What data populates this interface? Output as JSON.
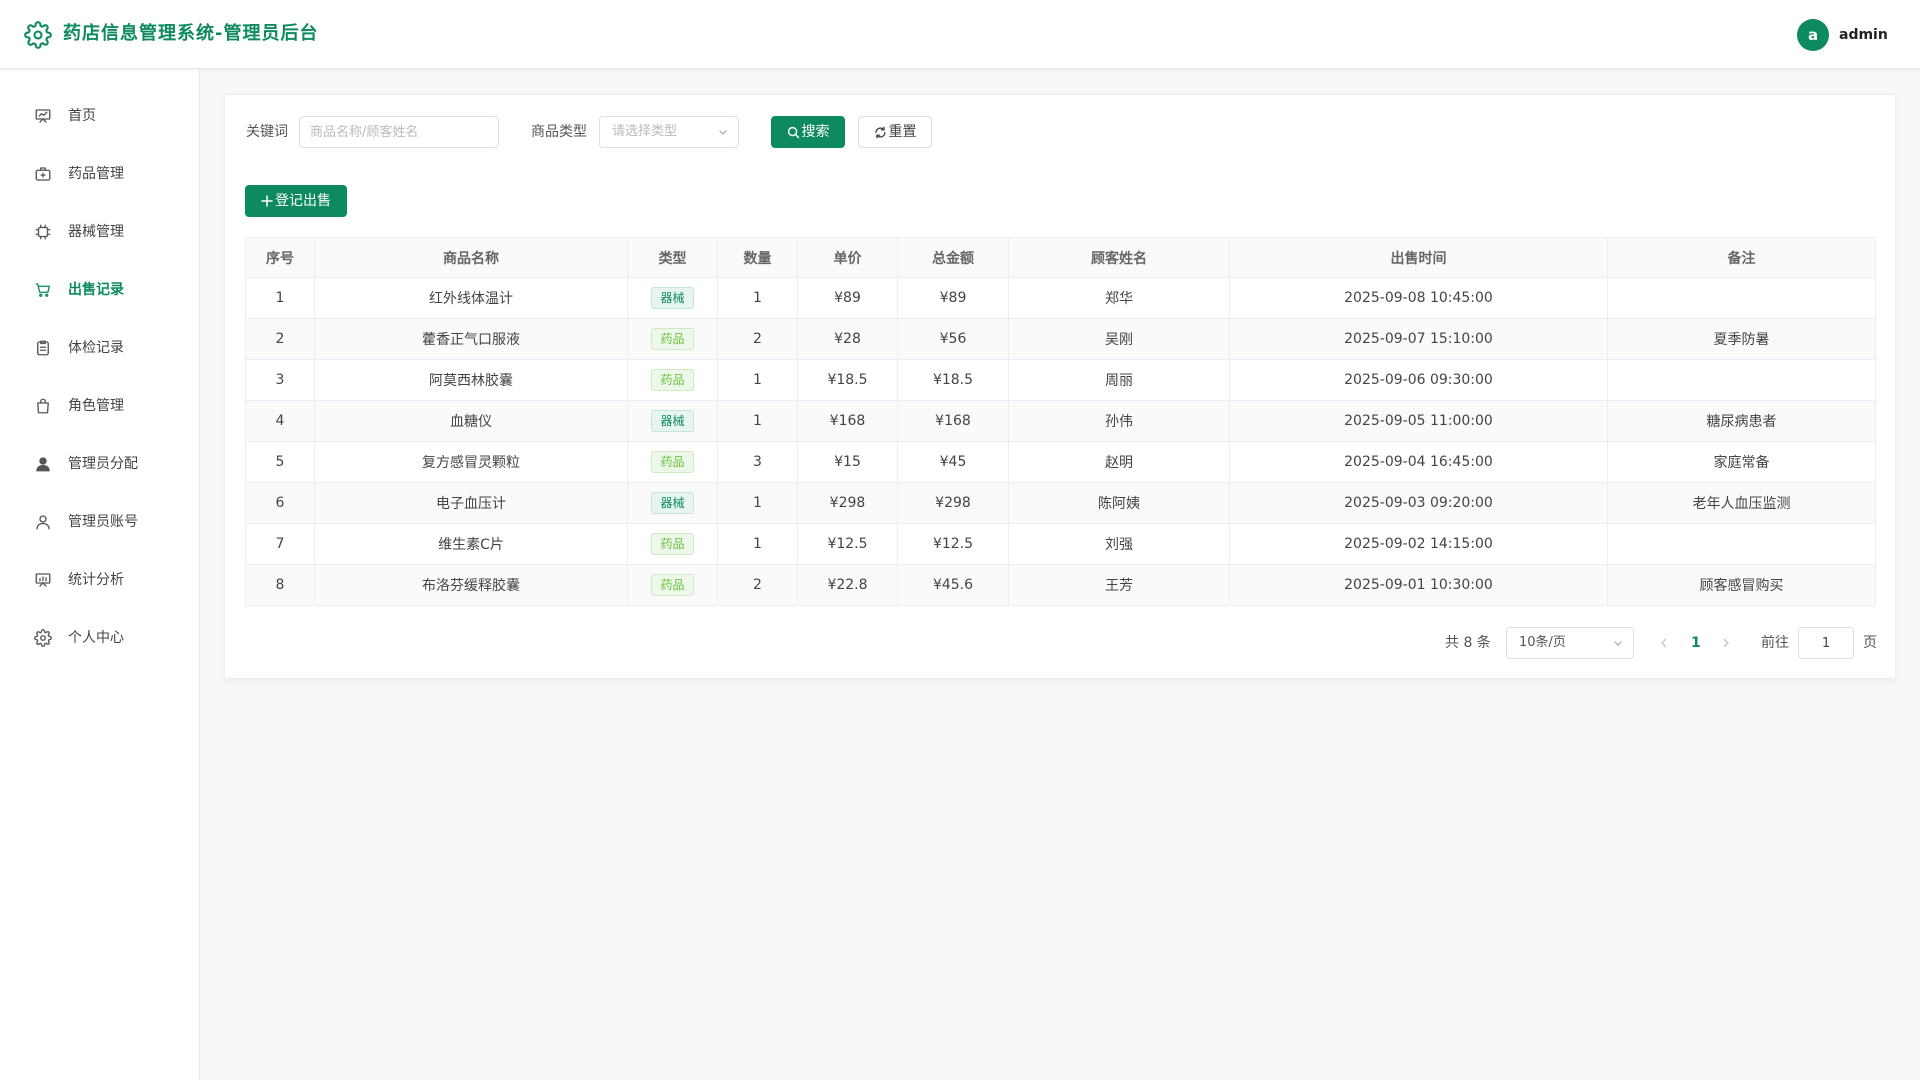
{
  "header": {
    "title": "药店信息管理系统-管理员后台",
    "avatar_letter": "a",
    "username": "admin"
  },
  "colors": {
    "primary": "#0e8a5f",
    "drug_tag": "#67c23a"
  },
  "sidebar": {
    "items": [
      {
        "label": "首页",
        "icon": "dashboard-icon",
        "active": false
      },
      {
        "label": "药品管理",
        "icon": "medical-kit-icon",
        "active": false
      },
      {
        "label": "器械管理",
        "icon": "chip-icon",
        "active": false
      },
      {
        "label": "出售记录",
        "icon": "cart-icon",
        "active": true
      },
      {
        "label": "体检记录",
        "icon": "clipboard-icon",
        "active": false
      },
      {
        "label": "角色管理",
        "icon": "bag-icon",
        "active": false
      },
      {
        "label": "管理员分配",
        "icon": "user-filled-icon",
        "active": false
      },
      {
        "label": "管理员账号",
        "icon": "user-icon",
        "active": false
      },
      {
        "label": "统计分析",
        "icon": "chart-icon",
        "active": false
      },
      {
        "label": "个人中心",
        "icon": "gear-icon",
        "active": false
      }
    ]
  },
  "filters": {
    "keyword_label": "关键词",
    "keyword_placeholder": "商品名称/顾客姓名",
    "type_label": "商品类型",
    "type_placeholder": "请选择类型",
    "search_label": "搜索",
    "reset_label": "重置"
  },
  "add_button_label": "登记出售",
  "table": {
    "columns": [
      "序号",
      "商品名称",
      "类型",
      "数量",
      "单价",
      "总金额",
      "顾客姓名",
      "出售时间",
      "备注"
    ],
    "rows": [
      {
        "no": "1",
        "name": "红外线体温计",
        "type": "器械",
        "qty": "1",
        "price": "¥89",
        "total": "¥89",
        "customer": "郑华",
        "time": "2025-09-08 10:45:00",
        "note": ""
      },
      {
        "no": "2",
        "name": "藿香正气口服液",
        "type": "药品",
        "qty": "2",
        "price": "¥28",
        "total": "¥56",
        "customer": "吴刚",
        "time": "2025-09-07 15:10:00",
        "note": "夏季防暑"
      },
      {
        "no": "3",
        "name": "阿莫西林胶囊",
        "type": "药品",
        "qty": "1",
        "price": "¥18.5",
        "total": "¥18.5",
        "customer": "周丽",
        "time": "2025-09-06 09:30:00",
        "note": ""
      },
      {
        "no": "4",
        "name": "血糖仪",
        "type": "器械",
        "qty": "1",
        "price": "¥168",
        "total": "¥168",
        "customer": "孙伟",
        "time": "2025-09-05 11:00:00",
        "note": "糖尿病患者"
      },
      {
        "no": "5",
        "name": "复方感冒灵颗粒",
        "type": "药品",
        "qty": "3",
        "price": "¥15",
        "total": "¥45",
        "customer": "赵明",
        "time": "2025-09-04 16:45:00",
        "note": "家庭常备"
      },
      {
        "no": "6",
        "name": "电子血压计",
        "type": "器械",
        "qty": "1",
        "price": "¥298",
        "total": "¥298",
        "customer": "陈阿姨",
        "time": "2025-09-03 09:20:00",
        "note": "老年人血压监测"
      },
      {
        "no": "7",
        "name": "维生素C片",
        "type": "药品",
        "qty": "1",
        "price": "¥12.5",
        "total": "¥12.5",
        "customer": "刘强",
        "time": "2025-09-02 14:15:00",
        "note": ""
      },
      {
        "no": "8",
        "name": "布洛芬缓释胶囊",
        "type": "药品",
        "qty": "2",
        "price": "¥22.8",
        "total": "¥45.6",
        "customer": "王芳",
        "time": "2025-09-01 10:30:00",
        "note": "顾客感冒购买"
      }
    ]
  },
  "pagination": {
    "total_text": "共 8 条",
    "page_size": "10条/页",
    "current_page": "1",
    "goto_label": "前往",
    "goto_value": "1",
    "page_unit": "页"
  }
}
